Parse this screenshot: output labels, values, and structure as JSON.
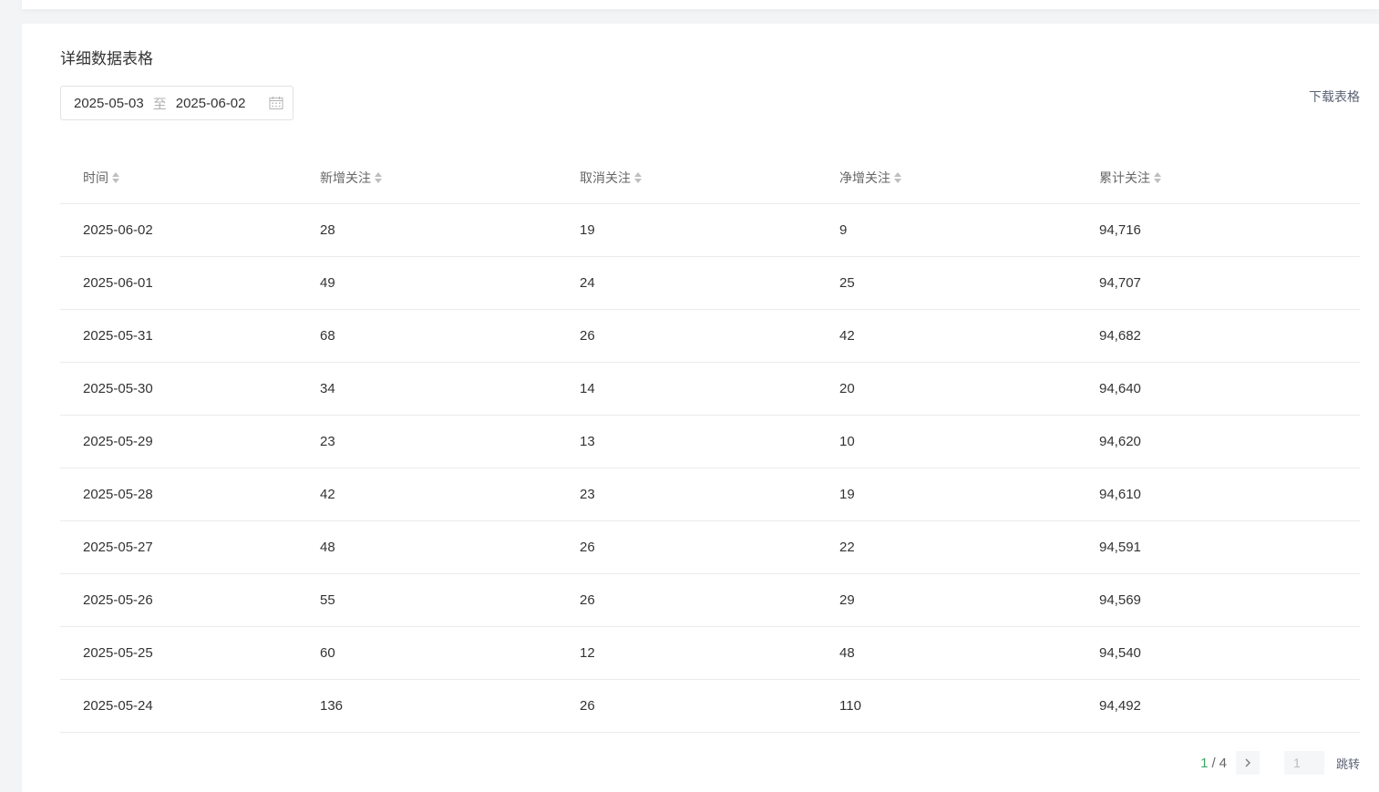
{
  "section_title": "详细数据表格",
  "date_range": {
    "start": "2025-05-03",
    "separator": "至",
    "end": "2025-06-02"
  },
  "download_label": "下载表格",
  "table": {
    "columns": [
      "时间",
      "新增关注",
      "取消关注",
      "净增关注",
      "累计关注"
    ],
    "rows": [
      [
        "2025-06-02",
        "28",
        "19",
        "9",
        "94,716"
      ],
      [
        "2025-06-01",
        "49",
        "24",
        "25",
        "94,707"
      ],
      [
        "2025-05-31",
        "68",
        "26",
        "42",
        "94,682"
      ],
      [
        "2025-05-30",
        "34",
        "14",
        "20",
        "94,640"
      ],
      [
        "2025-05-29",
        "23",
        "13",
        "10",
        "94,620"
      ],
      [
        "2025-05-28",
        "42",
        "23",
        "19",
        "94,610"
      ],
      [
        "2025-05-27",
        "48",
        "26",
        "22",
        "94,591"
      ],
      [
        "2025-05-26",
        "55",
        "26",
        "29",
        "94,569"
      ],
      [
        "2025-05-25",
        "60",
        "12",
        "48",
        "94,540"
      ],
      [
        "2025-05-24",
        "136",
        "26",
        "110",
        "94,492"
      ]
    ]
  },
  "pagination": {
    "current": "1",
    "total": "4",
    "slash": "/",
    "input_value": "1",
    "jump_label": "跳转"
  },
  "icons": {
    "calendar": "calendar-icon",
    "sort": "sort-icon",
    "next": "chevron-right-icon"
  },
  "colors": {
    "accent_green": "#3aa869",
    "link": "#5b6275",
    "border": "#ebebeb"
  }
}
